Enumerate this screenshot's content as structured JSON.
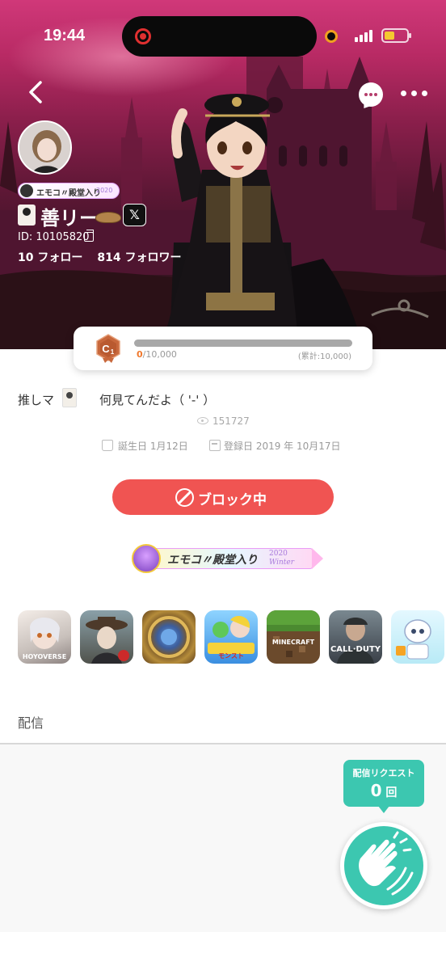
{
  "status_bar": {
    "time": "19:44",
    "battery_level": 0.45,
    "battery_color": "#f4c830",
    "recording_color": "#e03030"
  },
  "header": {
    "back_icon": "chevron-left-icon",
    "message_icon": "chat-bubble-icon",
    "more_icon": "more-horizontal-icon"
  },
  "profile": {
    "hall_badge_small": "エモコ〃殿堂入り",
    "hall_badge_small_year": "2020",
    "name": "善リー",
    "x_link_label": "𝕏",
    "user_id": "ID: 10105820",
    "following": "10 フォロー",
    "followers": "814 フォロワー"
  },
  "level": {
    "rank": "C1",
    "current_xp_value": "0",
    "current_xp_rest": "/10,000",
    "total_xp": "(累計:10,000)",
    "progress": 0.0
  },
  "bio": {
    "prefix": "推しマ",
    "text": "何見てんだよ（ '-' ）"
  },
  "stats": {
    "views": "151727",
    "birthday": "誕生日 1月12日",
    "registered": "登録日 2019 年 10月17日"
  },
  "actions": {
    "block_label": "ブロック中",
    "block_color": "#f05452"
  },
  "hall_badge": {
    "title": "エモコ〃殿堂入り",
    "year": "2020",
    "season": "Winter"
  },
  "games": [
    {
      "name": "HoYoverse",
      "label": "HOYOVERSE"
    },
    {
      "name": "Identity V",
      "label": ""
    },
    {
      "name": "Hearthstone",
      "label": ""
    },
    {
      "name": "Monster Strike",
      "label": "モンスト"
    },
    {
      "name": "Minecraft",
      "label": "MINECRAFT"
    },
    {
      "name": "Call of Duty",
      "label": "CALL·DUTY"
    },
    {
      "name": "White Robot",
      "label": ""
    }
  ],
  "streaming": {
    "section_title": "配信",
    "request_label": "配信リクエスト",
    "request_count": "0",
    "request_unit": "回",
    "accent_color": "#3cc7b0",
    "clap_icon": "clapping-hands-icon"
  }
}
